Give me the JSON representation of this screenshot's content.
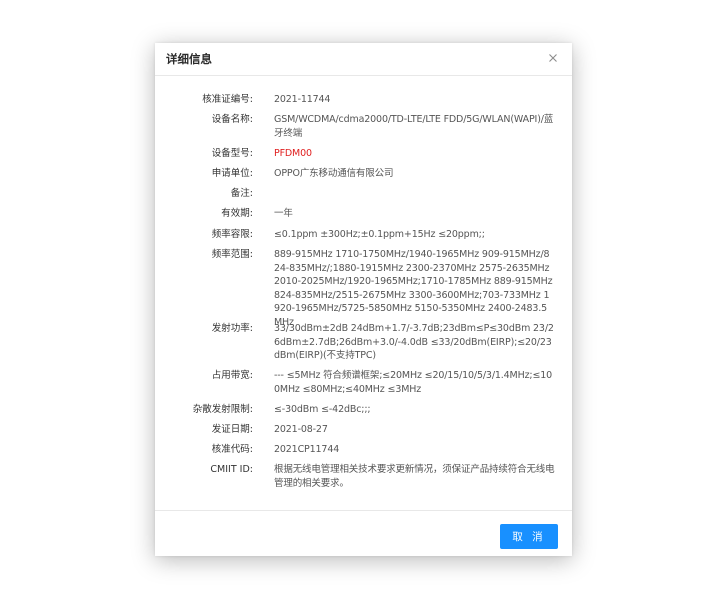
{
  "dialog": {
    "title": "详细信息",
    "close_icon": "close-icon",
    "cancel_label": "取 消",
    "accent_color": "#1890ff",
    "model_color": "#e02020"
  },
  "fields": [
    {
      "label": "核准证编号:",
      "value": "2021-11744"
    },
    {
      "label": "设备名称:",
      "value": "GSM/WCDMA/cdma2000/TD-LTE/LTE FDD/5G/WLAN(WAPI)/蓝牙终端"
    },
    {
      "label": "设备型号:",
      "value": "PFDM00"
    },
    {
      "label": "申请单位:",
      "value": "OPPO广东移动通信有限公司"
    },
    {
      "label": "备注:",
      "value": ""
    },
    {
      "label": "有效期:",
      "value": "一年"
    },
    {
      "label": "频率容限:",
      "value": "≤0.1ppm ±300Hz;±0.1ppm+15Hz ≤20ppm;;"
    },
    {
      "label": "频率范围:",
      "value": "889-915MHz 1710-1750MHz/1940-1965MHz 909-915MHz/824-835MHz/;1880-1915MHz 2300-2370MHz 2575-2635MHz 2010-2025MHz/1920-1965MHz;1710-1785MHz 889-915MHz 824-835MHz/2515-2675MHz 3300-3600MHz;703-733MHz 1920-1965MHz/5725-5850MHz 5150-5350MHz 2400-2483.5MHz"
    },
    {
      "label": "发射功率:",
      "value": "33/30dBm±2dB 24dBm+1.7/-3.7dB;23dBm≤P≤30dBm 23/26dBm±2.7dB;26dBm+3.0/-4.0dB ≤33/20dBm(EIRP);≤20/23dBm(EIRP)(不支持TPC)"
    },
    {
      "label": "占用带宽:",
      "value": "--- ≤5MHz 符合频谱框架;≤20MHz ≤20/15/10/5/3/1.4MHz;≤100MHz ≤80MHz;≤40MHz ≤3MHz"
    },
    {
      "label": "杂散发射限制:",
      "value": "≤-30dBm ≤-42dBc;;;"
    },
    {
      "label": "发证日期:",
      "value": "2021-08-27"
    },
    {
      "label": "核准代码:",
      "value": "2021CP11744"
    },
    {
      "label": "CMIIT ID:",
      "value": "根据无线电管理相关技术要求更新情况，须保证产品持续符合无线电管理的相关要求。"
    }
  ]
}
